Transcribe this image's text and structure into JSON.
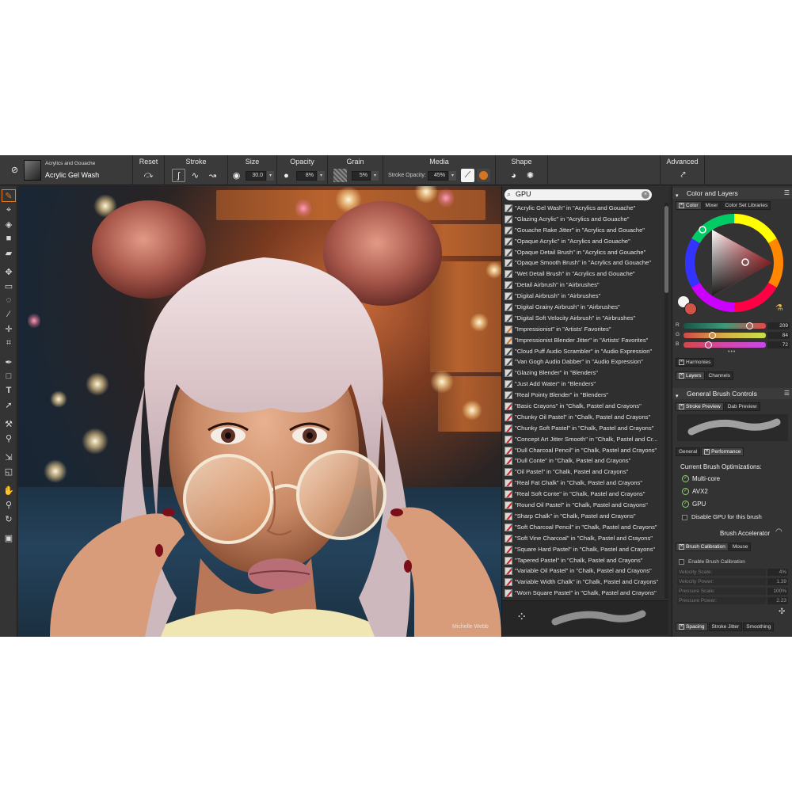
{
  "propbar": {
    "category": "Acrylics and Gouache",
    "variant": "Acrylic Gel Wash",
    "reset": "Reset",
    "stroke": "Stroke",
    "size": {
      "label": "Size",
      "value": "30.0"
    },
    "opacity": {
      "label": "Opacity",
      "value": "8%"
    },
    "grain": {
      "label": "Grain",
      "value": "5%"
    },
    "media": {
      "label": "Media",
      "stroke_opacity_label": "Stroke Opacity:",
      "stroke_opacity_value": "45%"
    },
    "shape": "Shape",
    "advanced": "Advanced"
  },
  "brush_search": {
    "query": "GPU",
    "results": [
      {
        "text": "\"Acrylic Gel Wash\" in \"Acrylics and Gouache\"",
        "icon": "gray"
      },
      {
        "text": "\"Glazing Acrylic\" in \"Acrylics and Gouache\"",
        "icon": "gray"
      },
      {
        "text": "\"Gouache Rake Jitter\" in \"Acrylics and Gouache\"",
        "icon": "gray"
      },
      {
        "text": "\"Opaque Acrylic\" in \"Acrylics and Gouache\"",
        "icon": "gray"
      },
      {
        "text": "\"Opaque Detail Brush\" in \"Acrylics and Gouache\"",
        "icon": "gray"
      },
      {
        "text": "\"Opaque Smooth Brush\" in \"Acrylics and Gouache\"",
        "icon": "gray"
      },
      {
        "text": "\"Wet Detail Brush\" in \"Acrylics and Gouache\"",
        "icon": "gray"
      },
      {
        "text": "\"Detail Airbrush\" in \"Airbrushes\"",
        "icon": "gray"
      },
      {
        "text": "\"Digital Airbrush\" in \"Airbrushes\"",
        "icon": "gray"
      },
      {
        "text": "\"Digital Grainy Airbrush\" in \"Airbrushes\"",
        "icon": "gray"
      },
      {
        "text": "\"Digital Soft Velocity Airbrush\" in \"Airbrushes\"",
        "icon": "gray"
      },
      {
        "text": "\"Impressionist\" in \"Artists' Favorites\"",
        "icon": "orange"
      },
      {
        "text": "\"Impressionist Blender Jitter\" in \"Artists' Favorites\"",
        "icon": "orange"
      },
      {
        "text": "\"Cloud Puff Audio Scrambler\" in \"Audio Expression\"",
        "icon": "gray"
      },
      {
        "text": "\"Van Gogh Audio Dabber\" in \"Audio Expression\"",
        "icon": "gray"
      },
      {
        "text": "\"Glazing Blender\" in \"Blenders\"",
        "icon": "gray"
      },
      {
        "text": "\"Just Add Water\" in \"Blenders\"",
        "icon": "gray"
      },
      {
        "text": "\"Real Pointy Blender\" in \"Blenders\"",
        "icon": "gray"
      },
      {
        "text": "\"Basic Crayons\" in \"Chalk, Pastel and Crayons\"",
        "icon": "red"
      },
      {
        "text": "\"Chunky Oil Pastel\" in \"Chalk, Pastel and Crayons\"",
        "icon": "red"
      },
      {
        "text": "\"Chunky Soft Pastel\" in \"Chalk, Pastel and Crayons\"",
        "icon": "red"
      },
      {
        "text": "\"Concept Art Jitter Smooth\" in \"Chalk, Pastel and Cr...",
        "icon": "red"
      },
      {
        "text": "\"Dull Charcoal Pencil\" in \"Chalk, Pastel and Crayons\"",
        "icon": "red"
      },
      {
        "text": "\"Dull Conte\" in \"Chalk, Pastel and Crayons\"",
        "icon": "red"
      },
      {
        "text": "\"Oil Pastel\" in \"Chalk, Pastel and Crayons\"",
        "icon": "red"
      },
      {
        "text": "\"Real Fat Chalk\" in \"Chalk, Pastel and Crayons\"",
        "icon": "red"
      },
      {
        "text": "\"Real Soft Conte\" in \"Chalk, Pastel and Crayons\"",
        "icon": "red"
      },
      {
        "text": "\"Round Oil Pastel\" in \"Chalk, Pastel and Crayons\"",
        "icon": "red"
      },
      {
        "text": "\"Sharp Chalk\" in \"Chalk, Pastel and Crayons\"",
        "icon": "red"
      },
      {
        "text": "\"Soft Charcoal Pencil\" in \"Chalk, Pastel and Crayons\"",
        "icon": "red"
      },
      {
        "text": "\"Soft Vine Charcoal\" in \"Chalk, Pastel and Crayons\"",
        "icon": "red"
      },
      {
        "text": "\"Square Hard Pastel\" in \"Chalk, Pastel and Crayons\"",
        "icon": "red"
      },
      {
        "text": "\"Tapered Pastel\" in \"Chalk, Pastel and Crayons\"",
        "icon": "red"
      },
      {
        "text": "\"Variable Oil Pastel\" in \"Chalk, Pastel and Crayons\"",
        "icon": "red"
      },
      {
        "text": "\"Variable Width Chalk\" in \"Chalk, Pastel and Crayons\"",
        "icon": "red"
      },
      {
        "text": "\"Worn Square Pastel\" in \"Chalk, Pastel and Crayons\"",
        "icon": "red"
      }
    ]
  },
  "color_panel": {
    "title": "Color and Layers",
    "tabs": [
      "Color",
      "Mixer",
      "Color Set Libraries"
    ],
    "rgb": [
      {
        "label": "R",
        "value": "209",
        "fraction": 0.82
      },
      {
        "label": "G",
        "value": "84",
        "fraction": 0.33
      },
      {
        "label": "B",
        "value": "72",
        "fraction": 0.28
      }
    ],
    "harmonies": "Harmonies",
    "layers_tabs": [
      "Layers",
      "Channels"
    ]
  },
  "brush_controls": {
    "title": "General Brush Controls",
    "tabs": [
      "Stroke Preview",
      "Dab Preview"
    ],
    "sub_tabs": [
      "General",
      "Performance"
    ],
    "optimizations_title": "Current Brush Optimizations:",
    "optimizations": [
      "Multi-core",
      "AVX2",
      "GPU"
    ],
    "disable_gpu": "Disable GPU for this brush",
    "accelerator": "Brush Accelerator",
    "calibration_tabs": [
      "Brush Calibration",
      "Mouse"
    ],
    "enable_calibration": "Enable Brush Calibration",
    "calibration": [
      {
        "label": "Velocity Scale:",
        "value": "4%"
      },
      {
        "label": "Velocity Power:",
        "value": "1.39"
      },
      {
        "label": "Pressure Scale:",
        "value": "100%"
      },
      {
        "label": "Pressure Power:",
        "value": "2.23"
      }
    ],
    "bottom_tabs": [
      "Spacing",
      "Stroke Jitter",
      "Smoothing"
    ]
  },
  "artwork": {
    "signature": "Michelle Webb"
  },
  "colors": {
    "accent": "#e07b1f",
    "panel": "#333333",
    "canvas_bg": "#1a2634"
  }
}
